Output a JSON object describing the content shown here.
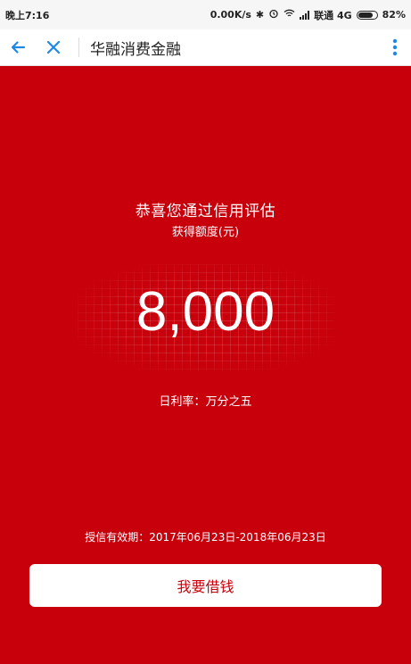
{
  "status_bar": {
    "time": "晚上7:16",
    "network_speed": "0.00K/s",
    "carrier": "联通 4G",
    "battery": "82%",
    "battery_level": 0.82
  },
  "app_bar": {
    "title": "华融消费金融",
    "accent_color": "#1e88e5"
  },
  "main": {
    "headline": "恭喜您通过信用评估",
    "subline": "获得额度(元)",
    "amount": "8,000",
    "daily_rate": "日利率：万分之五",
    "validity": "授信有效期：2017年06月23日-2018年06月23日",
    "borrow_button": "我要借钱",
    "background_color": "#c8000b"
  }
}
